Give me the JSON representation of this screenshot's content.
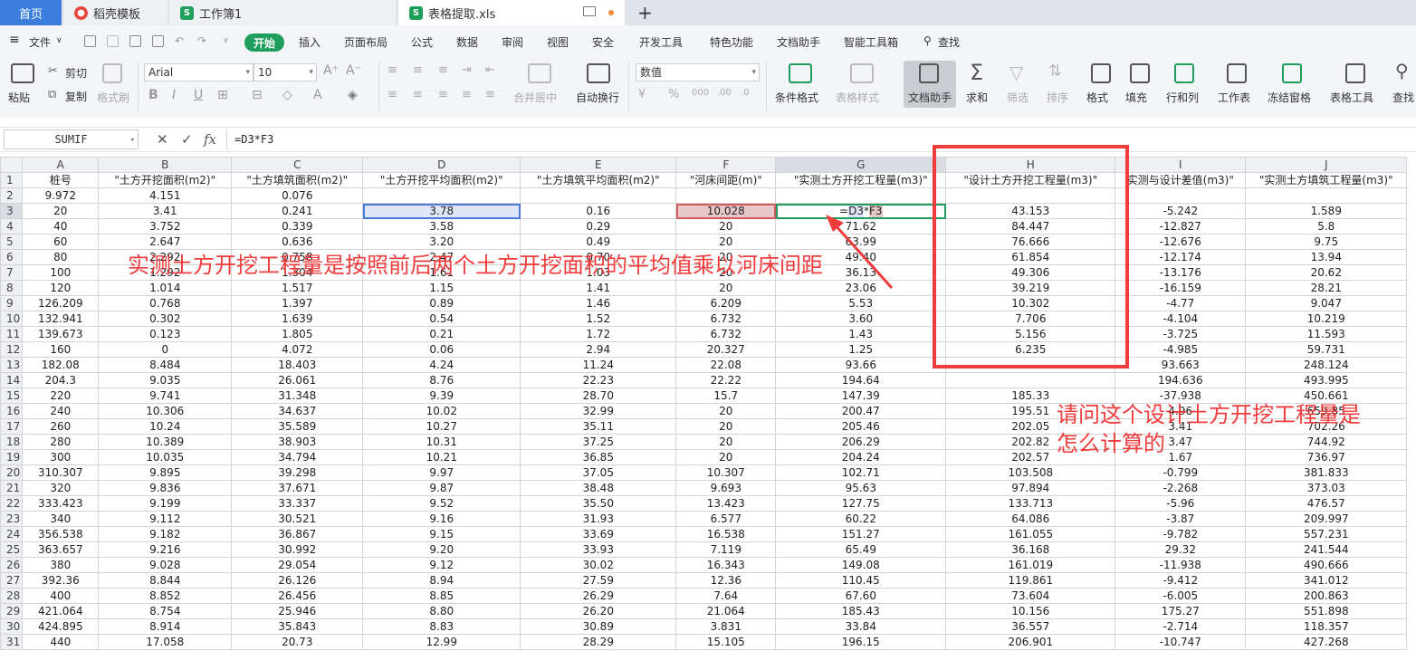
{
  "tabs": {
    "home": "首页",
    "items": [
      {
        "label": "稻壳模板",
        "icon": "docer-icon"
      },
      {
        "label": "工作簿1",
        "icon": "spreadsheet-icon"
      },
      {
        "label": "表格提取.xls",
        "icon": "spreadsheet-icon"
      }
    ],
    "new_tab": "+"
  },
  "menu": {
    "file": "文件",
    "items": [
      "插入",
      "页面布局",
      "公式",
      "数据",
      "审阅",
      "视图",
      "安全",
      "开发工具",
      "特色功能",
      "文档助手",
      "智能工具箱"
    ],
    "start": "开始",
    "search": "查找"
  },
  "ribbon": {
    "paste": "粘贴",
    "cut": "剪切",
    "copy": "复制",
    "format_painter": "格式刷",
    "font_name": "Arial",
    "font_size": "10",
    "merge": "合并居中",
    "wrap": "自动换行",
    "number_format": "数值",
    "cond_format": "条件格式",
    "table_style": "表格样式",
    "doc_assistant": "文档助手",
    "sum": "求和",
    "filter": "筛选",
    "sort": "排序",
    "format": "格式",
    "fill": "填充",
    "row_col": "行和列",
    "worksheet": "工作表",
    "freeze": "冻结窗格",
    "table_tools": "表格工具",
    "find": "查找"
  },
  "formula_bar": {
    "name_box": "SUMIF",
    "fx": "fx",
    "formula": "=D3*F3"
  },
  "sheet": {
    "columns": [
      "A",
      "B",
      "C",
      "D",
      "E",
      "F",
      "G",
      "H",
      "I",
      "J"
    ],
    "rows": [
      [
        "桩号",
        "\"土方开挖面积(m2)\"",
        "\"土方填筑面积(m2)\"",
        "\"土方开挖平均面积(m2)\"",
        "\"土方填筑平均面积(m2)\"",
        "\"河床间距(m)\"",
        "\"实测土方开挖工程量(m3)\"",
        "\"设计土方开挖工程量(m3)\"",
        "实测与设计差值(m3)\"",
        "\"实测土方填筑工程量(m3)\""
      ],
      [
        "9.972",
        "4.151",
        "0.076",
        "",
        "",
        "",
        "",
        "",
        "",
        ""
      ],
      [
        "20",
        "3.41",
        "0.241",
        "3.78",
        "0.16",
        "10.028",
        "=D3*F3",
        "43.153",
        "-5.242",
        "1.589"
      ],
      [
        "40",
        "3.752",
        "0.339",
        "3.58",
        "0.29",
        "20",
        "71.62",
        "84.447",
        "-12.827",
        "5.8"
      ],
      [
        "60",
        "2.647",
        "0.636",
        "3.20",
        "0.49",
        "20",
        "63.99",
        "76.666",
        "-12.676",
        "9.75"
      ],
      [
        "80",
        "2.292",
        "0.758",
        "2.47",
        "0.70",
        "20",
        "49.40",
        "61.854",
        "-12.174",
        "13.94"
      ],
      [
        "100",
        "1.292",
        "1.304",
        "1.61",
        "1.03",
        "20",
        "36.13",
        "49.306",
        "-13.176",
        "20.62"
      ],
      [
        "120",
        "1.014",
        "1.517",
        "1.15",
        "1.41",
        "20",
        "23.06",
        "39.219",
        "-16.159",
        "28.21"
      ],
      [
        "126.209",
        "0.768",
        "1.397",
        "0.89",
        "1.46",
        "6.209",
        "5.53",
        "10.302",
        "-4.77",
        "9.047"
      ],
      [
        "132.941",
        "0.302",
        "1.639",
        "0.54",
        "1.52",
        "6.732",
        "3.60",
        "7.706",
        "-4.104",
        "10.219"
      ],
      [
        "139.673",
        "0.123",
        "1.805",
        "0.21",
        "1.72",
        "6.732",
        "1.43",
        "5.156",
        "-3.725",
        "11.593"
      ],
      [
        "160",
        "0",
        "4.072",
        "0.06",
        "2.94",
        "20.327",
        "1.25",
        "6.235",
        "-4.985",
        "59.731"
      ],
      [
        "182.08",
        "8.484",
        "18.403",
        "4.24",
        "11.24",
        "22.08",
        "93.66",
        "",
        "93.663",
        "248.124"
      ],
      [
        "204.3",
        "9.035",
        "26.061",
        "8.76",
        "22.23",
        "22.22",
        "194.64",
        "",
        "194.636",
        "493.995"
      ],
      [
        "220",
        "9.741",
        "31.348",
        "9.39",
        "28.70",
        "15.7",
        "147.39",
        "185.33",
        "-37.938",
        "450.661"
      ],
      [
        "240",
        "10.306",
        "34.637",
        "10.02",
        "32.99",
        "20",
        "200.47",
        "195.51",
        "4.96",
        "659.85"
      ],
      [
        "260",
        "10.24",
        "35.589",
        "10.27",
        "35.11",
        "20",
        "205.46",
        "202.05",
        "3.41",
        "702.26"
      ],
      [
        "280",
        "10.389",
        "38.903",
        "10.31",
        "37.25",
        "20",
        "206.29",
        "202.82",
        "3.47",
        "744.92"
      ],
      [
        "300",
        "10.035",
        "34.794",
        "10.21",
        "36.85",
        "20",
        "204.24",
        "202.57",
        "1.67",
        "736.97"
      ],
      [
        "310.307",
        "9.895",
        "39.298",
        "9.97",
        "37.05",
        "10.307",
        "102.71",
        "103.508",
        "-0.799",
        "381.833"
      ],
      [
        "320",
        "9.836",
        "37.671",
        "9.87",
        "38.48",
        "9.693",
        "95.63",
        "97.894",
        "-2.268",
        "373.03"
      ],
      [
        "333.423",
        "9.199",
        "33.337",
        "9.52",
        "35.50",
        "13.423",
        "127.75",
        "133.713",
        "-5.96",
        "476.57"
      ],
      [
        "340",
        "9.112",
        "30.521",
        "9.16",
        "31.93",
        "6.577",
        "60.22",
        "64.086",
        "-3.87",
        "209.997"
      ],
      [
        "356.538",
        "9.182",
        "36.867",
        "9.15",
        "33.69",
        "16.538",
        "151.27",
        "161.055",
        "-9.782",
        "557.231"
      ],
      [
        "363.657",
        "9.216",
        "30.992",
        "9.20",
        "33.93",
        "7.119",
        "65.49",
        "36.168",
        "29.32",
        "241.544"
      ],
      [
        "380",
        "9.028",
        "29.054",
        "9.12",
        "30.02",
        "16.343",
        "149.08",
        "161.019",
        "-11.938",
        "490.666"
      ],
      [
        "392.36",
        "8.844",
        "26.126",
        "8.94",
        "27.59",
        "12.36",
        "110.45",
        "119.861",
        "-9.412",
        "341.012"
      ],
      [
        "400",
        "8.852",
        "26.456",
        "8.85",
        "26.29",
        "7.64",
        "67.60",
        "73.604",
        "-6.005",
        "200.863"
      ],
      [
        "421.064",
        "8.754",
        "25.946",
        "8.80",
        "26.20",
        "21.064",
        "185.43",
        "10.156",
        "175.27",
        "551.898"
      ],
      [
        "424.895",
        "8.914",
        "35.843",
        "8.83",
        "30.89",
        "3.831",
        "33.84",
        "36.557",
        "-2.714",
        "118.357"
      ],
      [
        "440",
        "17.058",
        "20.73",
        "12.99",
        "28.29",
        "15.105",
        "196.15",
        "206.901",
        "-10.747",
        "427.268"
      ]
    ],
    "g3_parts": [
      "=",
      "D3",
      "*",
      "F3"
    ]
  },
  "annotations": {
    "note1": "实测土方开挖工程量是按照前后两个土方开挖面积的平均值乘以河床间距",
    "note2_line1": "请问这个设计土方开挖工程量是",
    "note2_line2": "怎么计算的",
    "color": "#f03c3c"
  }
}
